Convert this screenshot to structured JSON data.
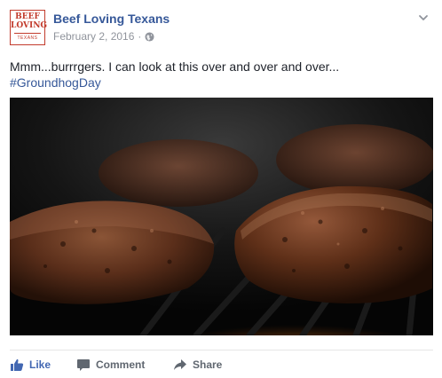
{
  "post": {
    "logo": {
      "line1": "BEEF",
      "line2": "LOVING",
      "line3": "TEXANS"
    },
    "page_name": "Beef Loving Texans",
    "date": "February 2, 2016",
    "separator": "·",
    "audience_icon": "globe-icon",
    "menu_icon": "chevron-down-icon",
    "text": "Mmm...burrrgers. I can look at this over and over and over...",
    "hashtag": "#GroundhogDay"
  },
  "actions": {
    "like_label": "Like",
    "comment_label": "Comment",
    "share_label": "Share"
  },
  "colors": {
    "link_blue": "#365899",
    "like_blue": "#4267b2",
    "meta_gray": "#90949c",
    "brand_red": "#c23b2c"
  }
}
